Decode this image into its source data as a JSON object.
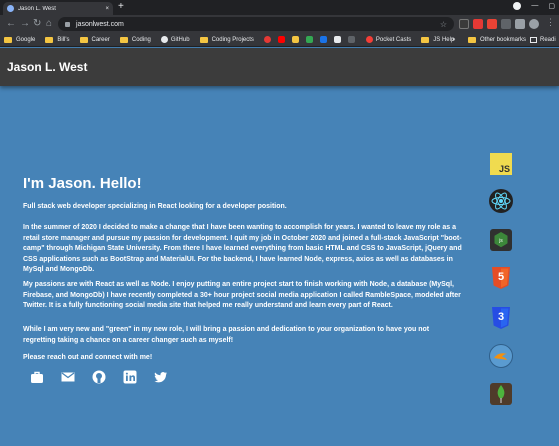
{
  "browser": {
    "tab_title": "Jason L. West",
    "tab_close": "×",
    "new_tab": "+",
    "url": "jasonlwest.com",
    "bookmarks": [
      "Google",
      "Bill's",
      "Career",
      "Coding",
      "GitHub",
      "Coding Projects",
      "Pocket Casts",
      "JS Help"
    ],
    "bookmarks_more": "»",
    "other_bookmarks": "Other bookmarks",
    "reading_list": "Readi"
  },
  "site": {
    "title": "Jason L. West"
  },
  "main": {
    "heading": "I'm Jason. Hello!",
    "paragraphs": [
      "Full stack web developer specializing in React looking for a developer position.",
      "In the summer of 2020 I decided to make a change that I have been wanting to accomplish for years. I wanted to leave my role as a retail store manager and pursue my passion for development. I quit my job in October 2020 and joined a full-stack JavaScript \"boot-camp\" through Michigan State University. From there I have learned everything from basic HTML and CSS to JavaScript, jQuery and CSS applications such as BootStrap and MaterialUI. For the backend, I have learned Node, express, axios as well as databases in MySql and MongoDb.",
      "My passions are with React as well as Node. I enjoy putting an entire project start to finish working with Node, a database (MySql, Firebase, and MongoDb) I have recently completed a 30+ hour project social media application I called RambleSpace, modeled after Twitter. It is a fully functioning social media site that helped me really understand and learn every part of React.",
      "While I am very new and \"green\" in my new role, I will bring a passion and dedication to your organization to have you not regretting taking a chance on a career changer such as myself!",
      "Please reach out and connect with me!"
    ]
  },
  "socials": [
    "briefcase-icon",
    "email-icon",
    "github-icon",
    "linkedin-icon",
    "twitter-icon"
  ],
  "skills": {
    "js_label": "JS",
    "html_label": "5",
    "css_label": "3"
  },
  "colors": {
    "background": "#4683b7",
    "header": "#3c3c3c"
  }
}
